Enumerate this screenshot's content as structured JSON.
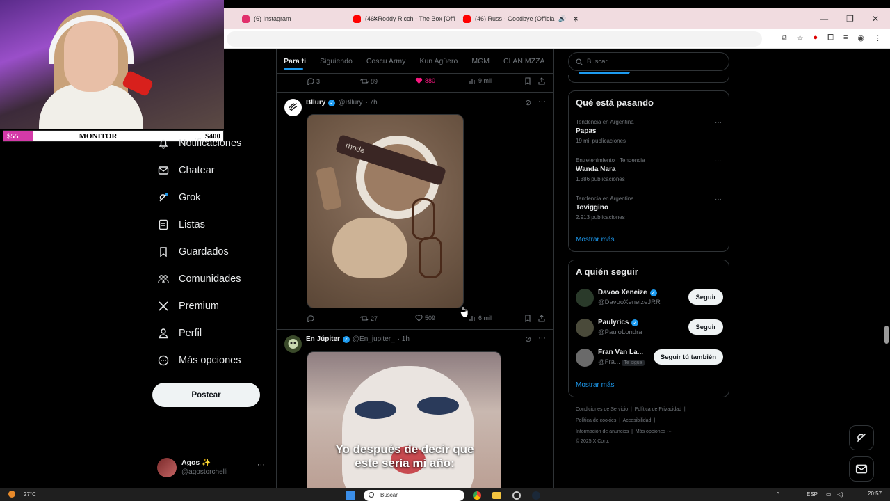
{
  "browser": {
    "tabs": [
      {
        "label": "(6) Instagram",
        "color": "#e1306c"
      },
      {
        "label": "(46) Roddy Ricch - The Box [Offi",
        "color": "#ff0000"
      },
      {
        "label": "(46) Russ - Goodbye (Officia",
        "color": "#ff0000"
      }
    ],
    "new_tab": "+",
    "window_controls": [
      "—",
      "❐",
      "✕"
    ]
  },
  "stream_overlay": {
    "left_value": "$55",
    "title": "MONITOR",
    "right_value": "$400"
  },
  "nav": {
    "items": [
      {
        "label": "Notificaciones",
        "icon": "bell-icon"
      },
      {
        "label": "Chatear",
        "icon": "mail-icon"
      },
      {
        "label": "Grok",
        "icon": "grok-icon"
      },
      {
        "label": "Listas",
        "icon": "list-icon"
      },
      {
        "label": "Guardados",
        "icon": "bookmark-icon"
      },
      {
        "label": "Comunidades",
        "icon": "communities-icon"
      },
      {
        "label": "Premium",
        "icon": "x-logo-icon"
      },
      {
        "label": "Perfil",
        "icon": "person-icon"
      },
      {
        "label": "Más opciones",
        "icon": "more-circle-icon"
      }
    ],
    "post_button": "Postear",
    "profile": {
      "name": "Agos ✨",
      "handle": "@agostorchelli",
      "more": "···"
    }
  },
  "timeline": {
    "tabs": [
      "Para ti",
      "Siguiendo",
      "Coscu Army",
      "Kun Agüero",
      "MGM",
      "CLAN MZZA"
    ],
    "prev_actions": {
      "replies": "3",
      "reposts": "89",
      "likes": "880",
      "views": "9 mil"
    },
    "tweets": [
      {
        "name": "Bllury",
        "handle": "@Bllury",
        "time": "· 7h",
        "image_text": "rhode",
        "actions": {
          "replies": "",
          "reposts": "27",
          "likes": "509",
          "views": "6 mil"
        }
      },
      {
        "name": "En Júpiter",
        "handle": "@En_jupiter_",
        "time": "· 1h",
        "caption": "Yo después de decir que este sería mi año:"
      }
    ]
  },
  "sidebar": {
    "search_placeholder": "Buscar",
    "trends_title": "Qué está pasando",
    "trends": [
      {
        "category": "Tendencia en Argentina",
        "title": "Papas",
        "count": "19 mil publicaciones"
      },
      {
        "category": "Entretenimiento · Tendencia",
        "title": "Wanda Nara",
        "count": "1.386 publicaciones"
      },
      {
        "category": "Tendencia en Argentina",
        "title": "Toviggino",
        "count": "2.913 publicaciones"
      }
    ],
    "trends_more": "Mostrar más",
    "follow_title": "A quién seguir",
    "follow": [
      {
        "name": "Davoo Xeneize",
        "handle": "@DavooXeneizeJRR",
        "button": "Seguir",
        "verified": true
      },
      {
        "name": "Paulyrics",
        "handle": "@PauloLondra",
        "button": "Seguir",
        "verified": true
      },
      {
        "name": "Fran Van La...",
        "handle": "@Fra...",
        "badge": "Te sigue",
        "button": "Seguir tú también",
        "verified": false
      }
    ],
    "follow_more": "Mostrar más",
    "footer_lines": [
      [
        "Condiciones de Servicio",
        "Política de Privacidad"
      ],
      [
        "Política de cookies",
        "Accesibilidad"
      ],
      [
        "Información de anuncios",
        "Más opciones ···"
      ],
      [
        "© 2025 X Corp."
      ]
    ]
  },
  "taskbar": {
    "weather": "27°C",
    "search": "Buscar",
    "lang": "ESP",
    "time": "20:57"
  },
  "colors": {
    "accent": "#1d9bf0",
    "like": "#f91880",
    "bg": "#000000",
    "border": "#2f3336"
  }
}
